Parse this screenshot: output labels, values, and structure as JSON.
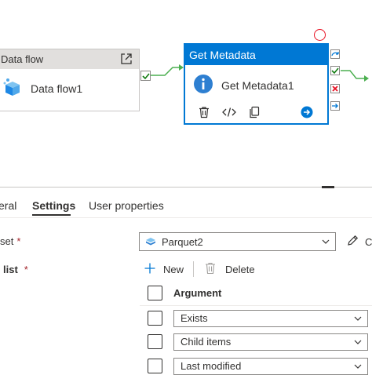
{
  "canvas": {
    "data_flow_node": {
      "header": "Data flow",
      "name": "Data flow1"
    },
    "metadata_node": {
      "header": "Get Metadata",
      "name": "Get Metadata1"
    }
  },
  "tabs": {
    "general": "eral",
    "settings": "Settings",
    "user_properties": "User properties"
  },
  "settings": {
    "dataset_label": "set",
    "dataset_value": "Parquet2",
    "dataset_edit_label": "C",
    "field_list_label": "list",
    "required_marker": "*",
    "new_label": "New",
    "delete_label": "Delete",
    "argument_header": "Argument",
    "arguments": [
      {
        "value": "Exists"
      },
      {
        "value": "Child items"
      },
      {
        "value": "Last modified"
      }
    ]
  },
  "colors": {
    "accent": "#0078d4",
    "success": "#107c10",
    "error": "#e81123"
  }
}
